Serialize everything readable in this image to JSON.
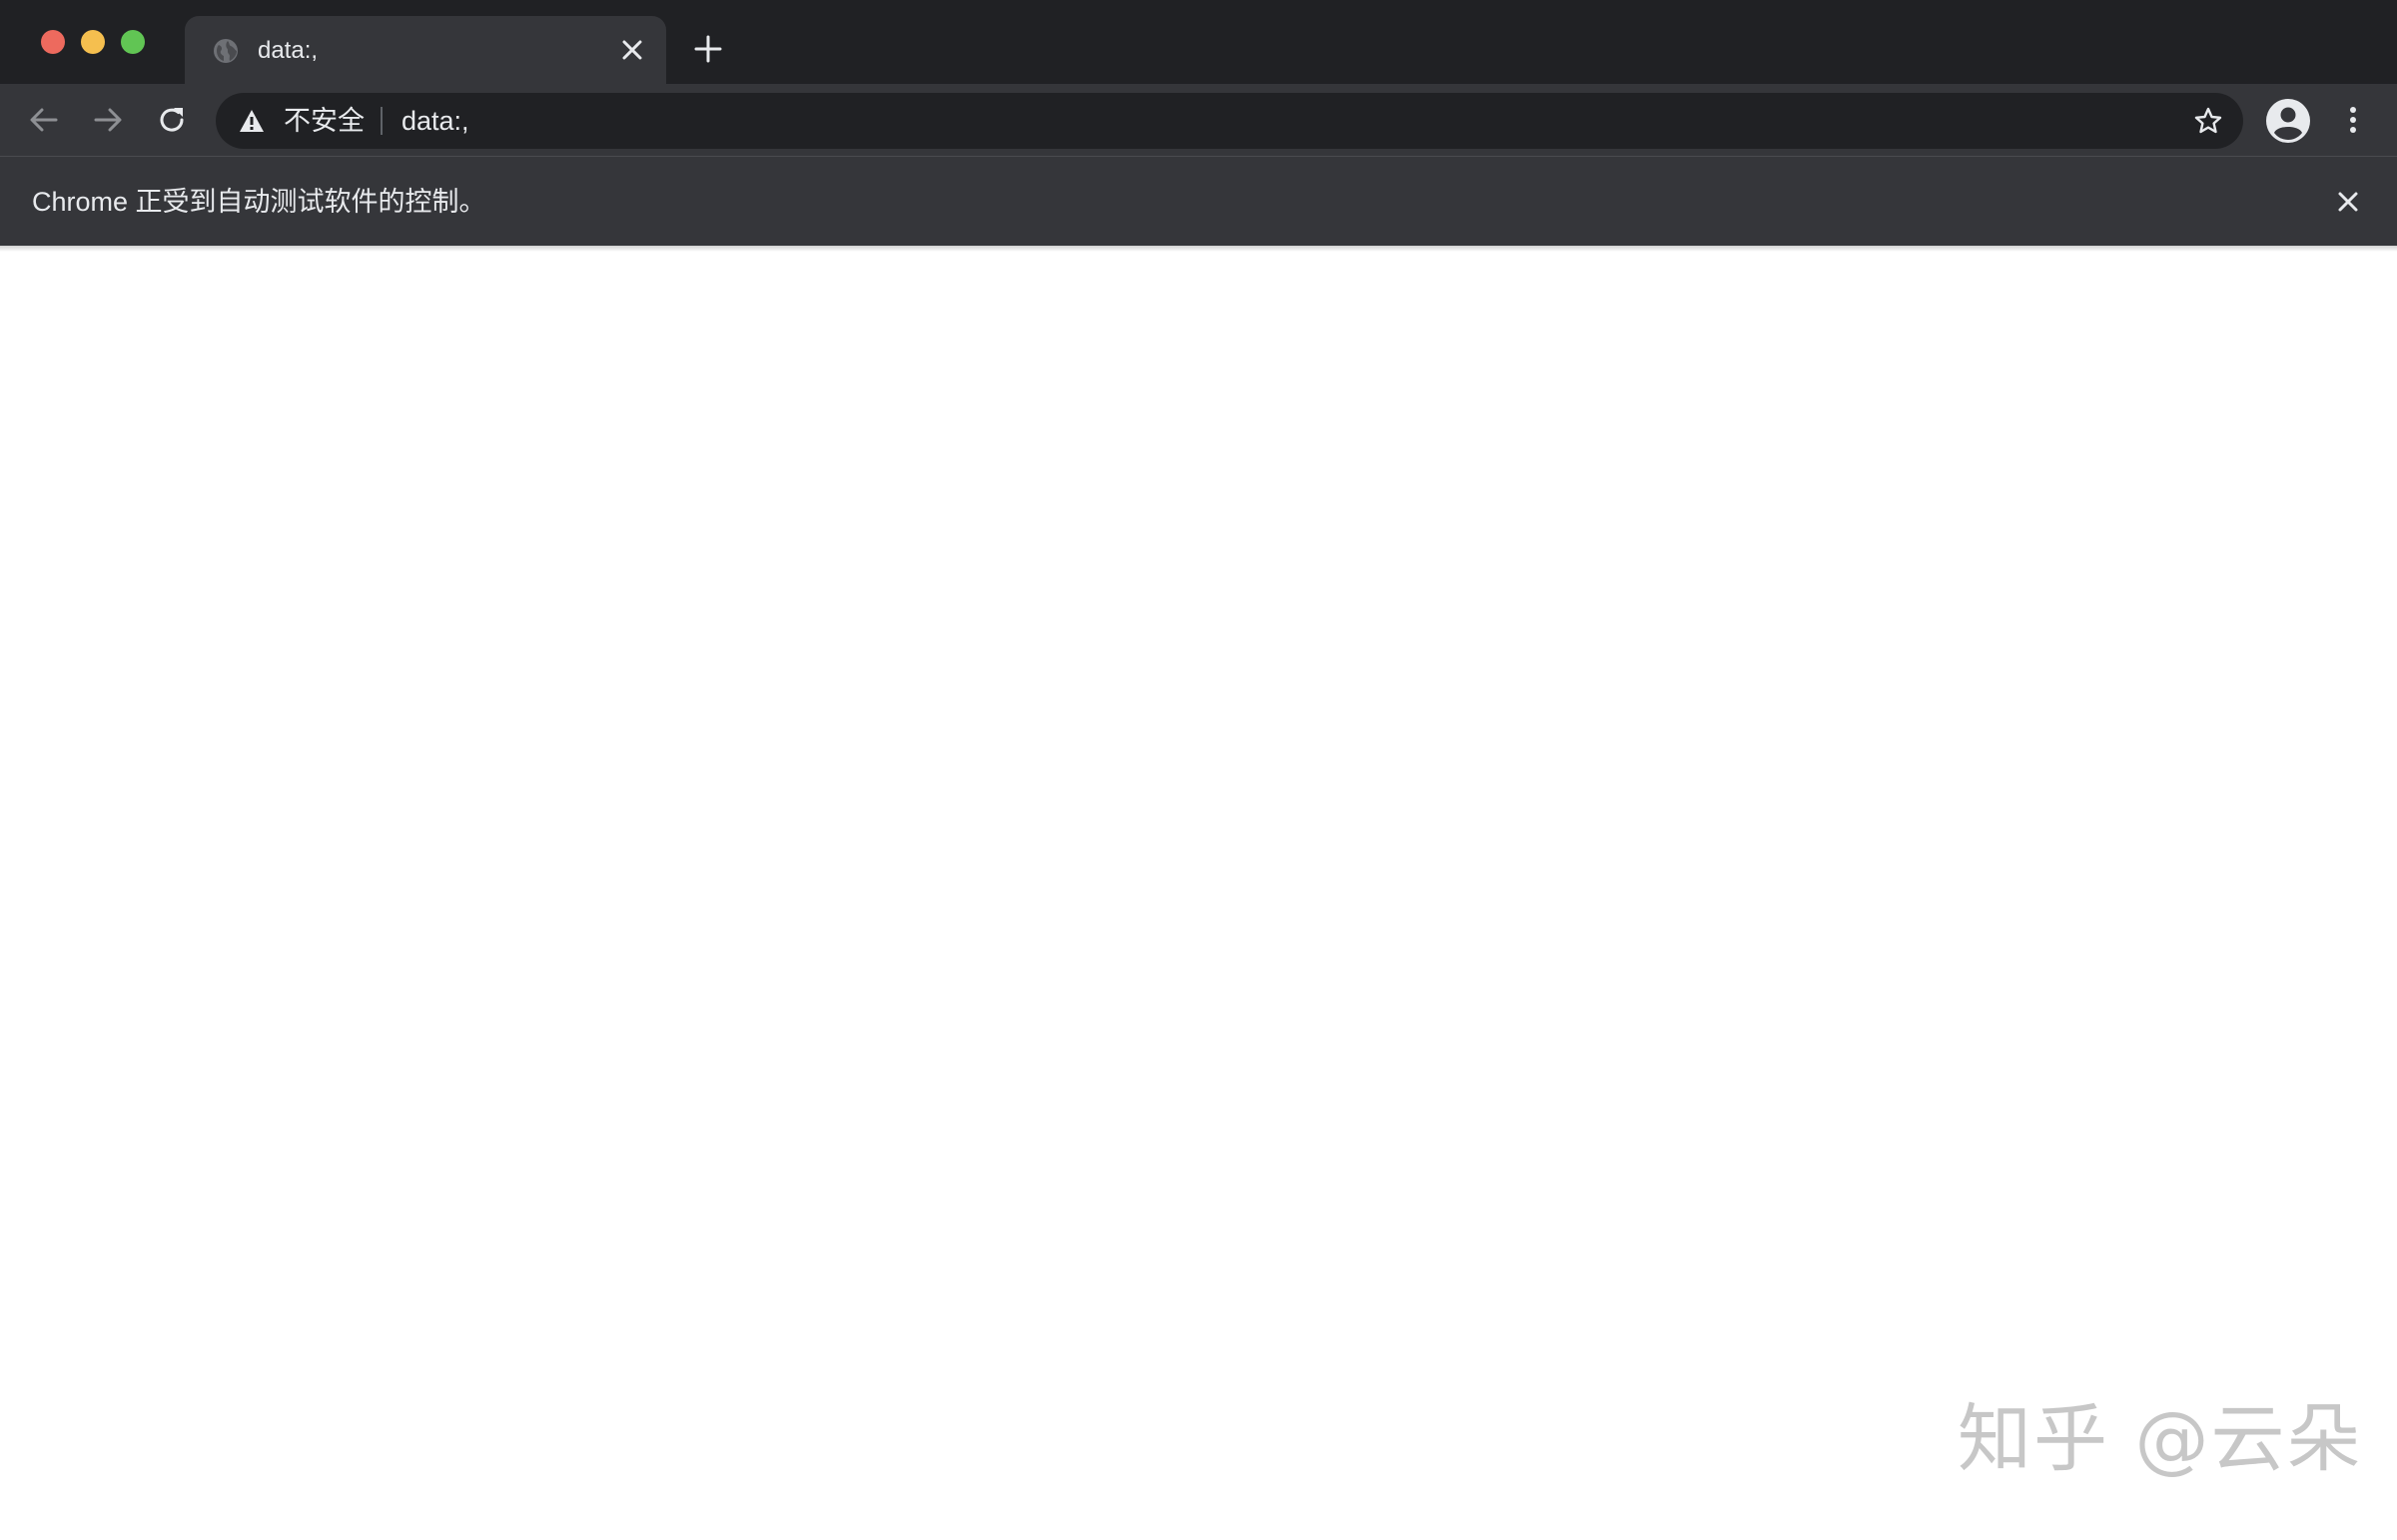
{
  "browser": {
    "tab": {
      "title": "data:,",
      "icon": "globe-icon"
    },
    "toolbar": {
      "back_icon": "arrow-left-icon",
      "forward_icon": "arrow-right-icon",
      "reload_icon": "reload-icon",
      "omnibox": {
        "security_label": "不安全",
        "url": "data:,",
        "warning_icon": "warning-triangle-icon",
        "bookmark_icon": "star-icon"
      },
      "profile_icon": "account-circle-icon",
      "menu_icon": "kebab-menu-icon"
    },
    "infobar": {
      "message": "Chrome 正受到自动测试软件的控制。"
    }
  },
  "watermark": "知乎 @云朵",
  "colors": {
    "frame": "#202124",
    "toolbar": "#35363a",
    "text": "#e8eaed",
    "close_red": "#ed6a5e",
    "minimize_yellow": "#f5bf4f",
    "zoom_green": "#61c554"
  }
}
